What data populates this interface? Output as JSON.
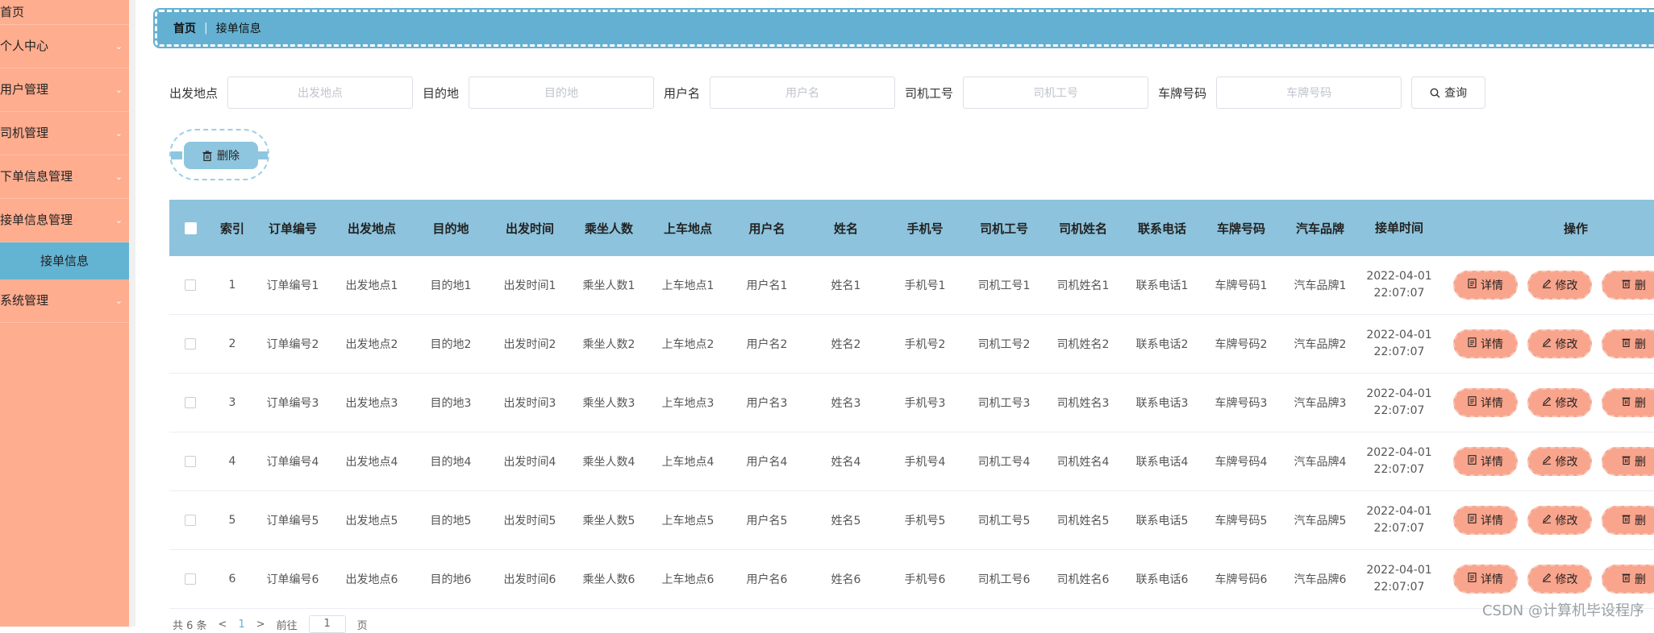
{
  "sidebar": {
    "items": [
      {
        "label": "首页",
        "has_chevron": false
      },
      {
        "label": "个人中心",
        "has_chevron": true
      },
      {
        "label": "用户管理",
        "has_chevron": true
      },
      {
        "label": "司机管理",
        "has_chevron": true
      },
      {
        "label": "下单信息管理",
        "has_chevron": true
      },
      {
        "label": "接单信息管理",
        "has_chevron": true,
        "expanded": true
      }
    ],
    "active_sub_item": "接单信息",
    "last_item": {
      "label": "系统管理",
      "has_chevron": true
    },
    "chevron": "⌄"
  },
  "breadcrumb": {
    "home": "首页",
    "separator": "|",
    "current": "接单信息"
  },
  "search": {
    "fields": [
      {
        "label": "出发地点",
        "placeholder": "出发地点"
      },
      {
        "label": "目的地",
        "placeholder": "目的地"
      },
      {
        "label": "用户名",
        "placeholder": "用户名"
      },
      {
        "label": "司机工号",
        "placeholder": "司机工号"
      },
      {
        "label": "车牌号码",
        "placeholder": "车牌号码"
      }
    ],
    "button_label": "查询",
    "button_icon": "search-icon"
  },
  "toolbar": {
    "delete_label": "删除",
    "delete_icon": "trash-icon"
  },
  "table": {
    "columns": [
      "索引",
      "订单编号",
      "出发地点",
      "目的地",
      "出发时间",
      "乘坐人数",
      "上车地点",
      "用户名",
      "姓名",
      "手机号",
      "司机工号",
      "司机姓名",
      "联系电话",
      "车牌号码",
      "汽车品牌",
      "接单时间",
      "操作"
    ],
    "rows": [
      {
        "index": "1",
        "order_no": "订单编号1",
        "departure": "出发地点1",
        "destination": "目的地1",
        "depart_time": "出发时间1",
        "passengers": "乘坐人数1",
        "pickup": "上车地点1",
        "username": "用户名1",
        "name": "姓名1",
        "phone": "手机号1",
        "driver_no": "司机工号1",
        "driver_name": "司机姓名1",
        "contact": "联系电话1",
        "plate": "车牌号码1",
        "brand": "汽车品牌1",
        "accept_date": "2022-04-01",
        "accept_time": "22:07:07"
      },
      {
        "index": "2",
        "order_no": "订单编号2",
        "departure": "出发地点2",
        "destination": "目的地2",
        "depart_time": "出发时间2",
        "passengers": "乘坐人数2",
        "pickup": "上车地点2",
        "username": "用户名2",
        "name": "姓名2",
        "phone": "手机号2",
        "driver_no": "司机工号2",
        "driver_name": "司机姓名2",
        "contact": "联系电话2",
        "plate": "车牌号码2",
        "brand": "汽车品牌2",
        "accept_date": "2022-04-01",
        "accept_time": "22:07:07"
      },
      {
        "index": "3",
        "order_no": "订单编号3",
        "departure": "出发地点3",
        "destination": "目的地3",
        "depart_time": "出发时间3",
        "passengers": "乘坐人数3",
        "pickup": "上车地点3",
        "username": "用户名3",
        "name": "姓名3",
        "phone": "手机号3",
        "driver_no": "司机工号3",
        "driver_name": "司机姓名3",
        "contact": "联系电话3",
        "plate": "车牌号码3",
        "brand": "汽车品牌3",
        "accept_date": "2022-04-01",
        "accept_time": "22:07:07"
      },
      {
        "index": "4",
        "order_no": "订单编号4",
        "departure": "出发地点4",
        "destination": "目的地4",
        "depart_time": "出发时间4",
        "passengers": "乘坐人数4",
        "pickup": "上车地点4",
        "username": "用户名4",
        "name": "姓名4",
        "phone": "手机号4",
        "driver_no": "司机工号4",
        "driver_name": "司机姓名4",
        "contact": "联系电话4",
        "plate": "车牌号码4",
        "brand": "汽车品牌4",
        "accept_date": "2022-04-01",
        "accept_time": "22:07:07"
      },
      {
        "index": "5",
        "order_no": "订单编号5",
        "departure": "出发地点5",
        "destination": "目的地5",
        "depart_time": "出发时间5",
        "passengers": "乘坐人数5",
        "pickup": "上车地点5",
        "username": "用户名5",
        "name": "姓名5",
        "phone": "手机号5",
        "driver_no": "司机工号5",
        "driver_name": "司机姓名5",
        "contact": "联系电话5",
        "plate": "车牌号码5",
        "brand": "汽车品牌5",
        "accept_date": "2022-04-01",
        "accept_time": "22:07:07"
      },
      {
        "index": "6",
        "order_no": "订单编号6",
        "departure": "出发地点6",
        "destination": "目的地6",
        "depart_time": "出发时间6",
        "passengers": "乘坐人数6",
        "pickup": "上车地点6",
        "username": "用户名6",
        "name": "姓名6",
        "phone": "手机号6",
        "driver_no": "司机工号6",
        "driver_name": "司机姓名6",
        "contact": "联系电话6",
        "plate": "车牌号码6",
        "brand": "汽车品牌6",
        "accept_date": "2022-04-01",
        "accept_time": "22:07:07"
      }
    ],
    "actions": [
      {
        "label": "详情",
        "icon": "document-icon"
      },
      {
        "label": "修改",
        "icon": "edit-icon"
      },
      {
        "label": "删",
        "icon": "trash-icon"
      }
    ]
  },
  "pagination": {
    "total_text": "共 6 条",
    "prev": "<",
    "current_page": "1",
    "next": ">",
    "goto_label": "前往",
    "goto_value": "1",
    "page_unit": "页"
  },
  "watermark": "CSDN @计算机毕设程序",
  "colors": {
    "sidebar_bg": "#ffad8f",
    "accent_blue": "#63b0d2",
    "header_blue": "#8dc3dc",
    "action_btn": "#f9a48c"
  }
}
